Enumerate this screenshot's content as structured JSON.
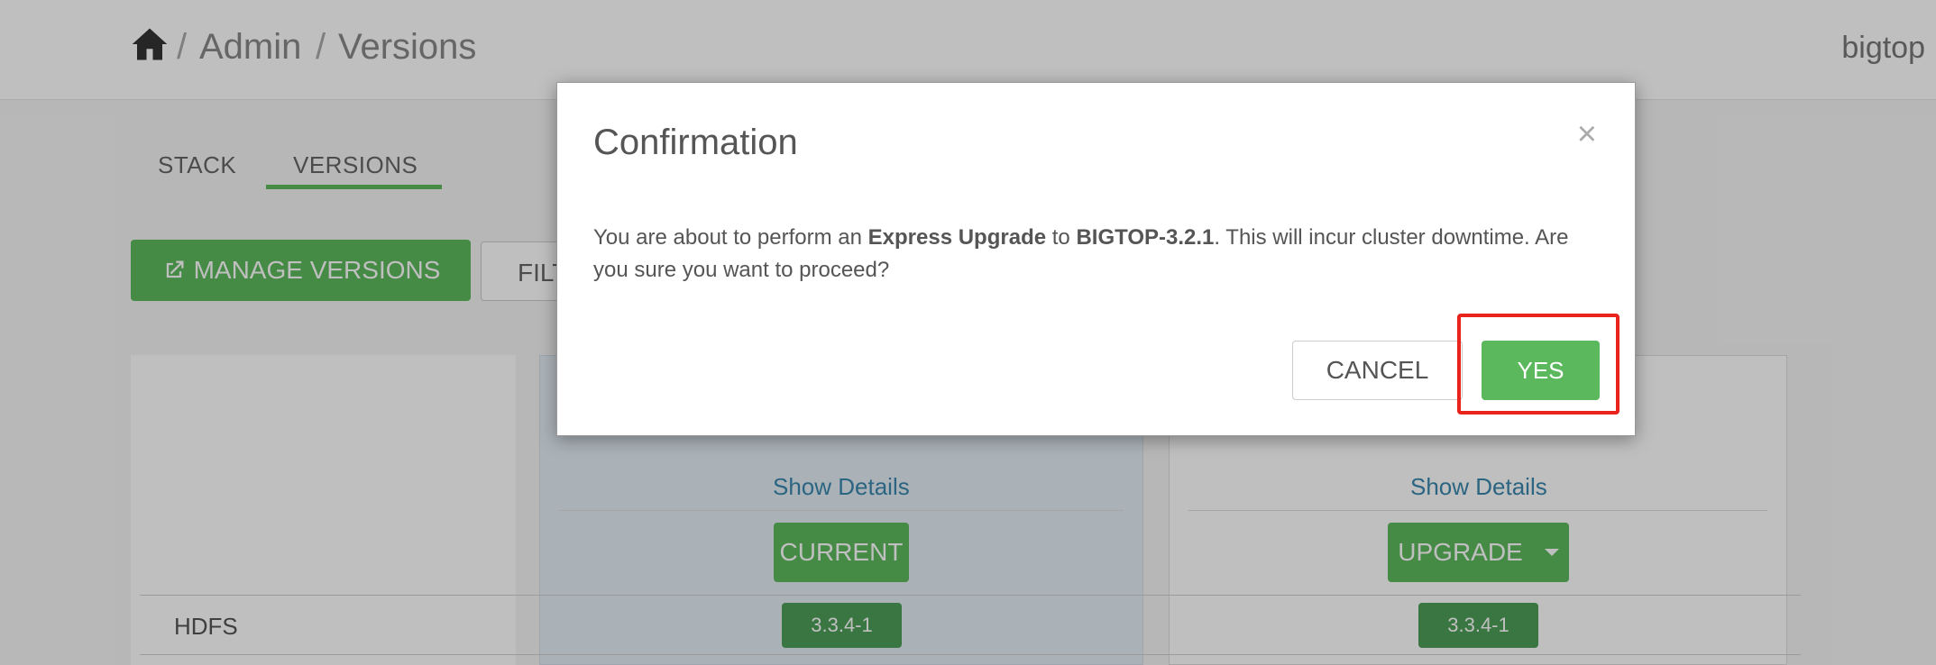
{
  "breadcrumb": {
    "home_icon": "home-icon",
    "sep": "/",
    "admin": "Admin",
    "versions": "Versions"
  },
  "user": {
    "name": "bigtop"
  },
  "tabs": [
    {
      "label": "STACK"
    },
    {
      "label": "VERSIONS",
      "active": true
    }
  ],
  "toolbar": {
    "manage_icon": "external-link-icon",
    "manage_label": "MANAGE VERSIONS",
    "filter_label": "FILTER"
  },
  "versions": {
    "current": {
      "show_details": "Show Details",
      "status_label": "CURRENT",
      "hdfs_version": "3.3.4-1"
    },
    "target": {
      "show_details": "Show Details",
      "action_label": "UPGRADE",
      "hdfs_version": "3.3.4-1"
    }
  },
  "services": [
    {
      "name": "HDFS"
    }
  ],
  "modal": {
    "title": "Confirmation",
    "close_glyph": "×",
    "body_prefix": "You are about to perform an ",
    "upgrade_type": "Express Upgrade",
    "body_mid": " to ",
    "target_version": "BIGTOP-3.2.1",
    "body_suffix": ". This will incur cluster downtime. Are you sure you want to proceed?",
    "cancel_label": "CANCEL",
    "yes_label": "YES"
  },
  "colors": {
    "accent": "#5cb85c",
    "link": "#3a87ad",
    "highlight": "#e8231b"
  }
}
